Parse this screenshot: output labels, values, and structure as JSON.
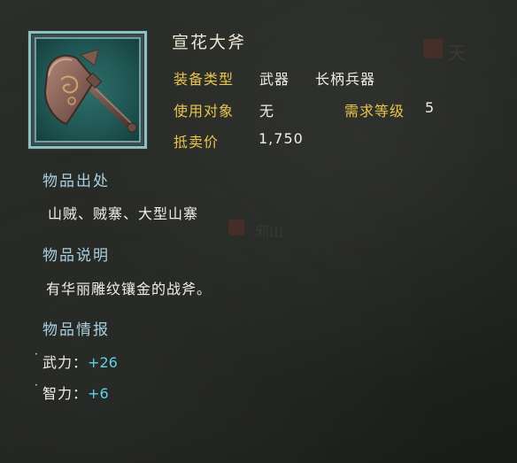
{
  "item": {
    "name": "宣花大斧",
    "icon": "battle-axe-icon"
  },
  "attributes": {
    "equip_type_label": "装备类型",
    "equip_type_value_1": "武器",
    "equip_type_value_2": "长柄兵器",
    "user_label": "使用对象",
    "user_value": "无",
    "level_label": "需求等级",
    "level_value": "5",
    "price_label": "抵卖价",
    "price_value": "1,750"
  },
  "sections": {
    "source_heading": "物品出处",
    "source_text": "山贼、贼寨、大型山寨",
    "desc_heading": "物品说明",
    "desc_text": "有华丽雕纹镶金的战斧。",
    "info_heading": "物品情报"
  },
  "stats": [
    {
      "name": "武力",
      "value": "+26"
    },
    {
      "name": "智力",
      "value": "+6"
    }
  ],
  "background_marks": {
    "mark_1": "天",
    "mark_2": "邪山"
  },
  "colors": {
    "label_gold": "#e9c54e",
    "heading_blue": "#a9cfe0",
    "stat_cyan": "#5fd2e6",
    "frame_teal": "#8dbfc3"
  }
}
